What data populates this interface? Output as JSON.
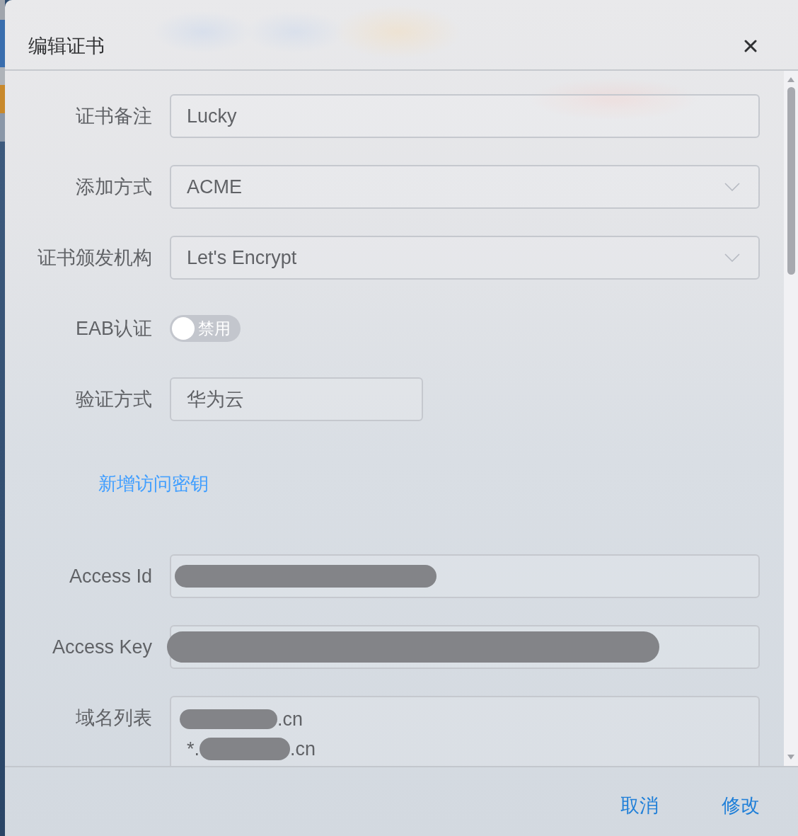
{
  "dialog": {
    "title": "编辑证书"
  },
  "form": {
    "items": [
      {
        "kind": "input",
        "label": "证书备注",
        "value": "Lucky",
        "redacted": false
      },
      {
        "kind": "select",
        "label": "添加方式",
        "value": "ACME"
      },
      {
        "kind": "select",
        "label": "证书颁发机构",
        "value": "Let's Encrypt"
      },
      {
        "kind": "switch",
        "label": "EAB认证",
        "on": false,
        "text": "禁用"
      },
      {
        "kind": "display",
        "label": "验证方式",
        "value": "华为云"
      },
      {
        "kind": "link",
        "text": "新增访问密钥"
      },
      {
        "kind": "input",
        "label": "Access Id",
        "redacted": true
      },
      {
        "kind": "input",
        "label": "Access Key",
        "redacted": true
      },
      {
        "kind": "textarea",
        "label": "域名列表",
        "lines": [
          {
            "parts": [
              {
                "kind": "redaction"
              },
              {
                "kind": "text",
                "text": ".cn"
              }
            ]
          },
          {
            "parts": [
              {
                "kind": "text",
                "text": "*."
              },
              {
                "kind": "redaction"
              },
              {
                "kind": "text",
                "text": ".cn"
              }
            ]
          }
        ]
      }
    ]
  },
  "footer": {
    "buttons": [
      {
        "label": "取消"
      },
      {
        "label": "修改"
      }
    ]
  }
}
